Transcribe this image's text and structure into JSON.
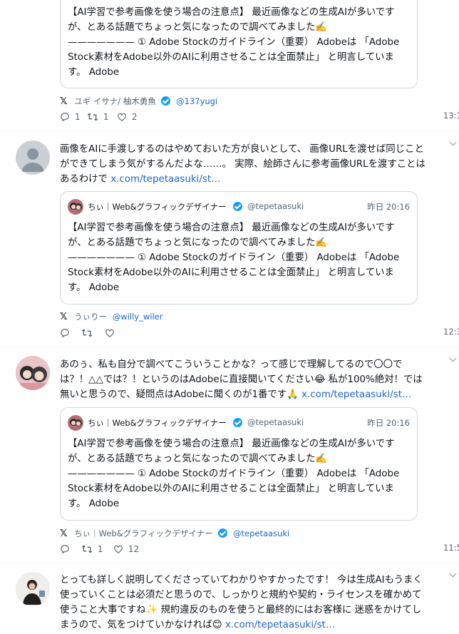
{
  "items": [
    {
      "quote_text": "【AI学習で参考画像を使う場合の注意点】 最近画像などの生成AIが多いですが、とある話題でちょっと気になったので調べてみました✍️\n——————— ① Adobe Stockのガイドライン（重要） Adobeは 「Adobe Stock素材をAdobe以外のAIに利用させることは全面禁止」 と明言しています。 Adobe",
      "source_name": "ユギ イサナ/ 柚木勇魚",
      "source_handle": "@137yugi",
      "reply_count": "1",
      "retweet_count": "1",
      "like_count": "2",
      "time": "13:1"
    },
    {
      "text": "画像をAIに手渡しするのはやめておいた方が良いとして、 画像URLを渡せば同じことができてしまう気がするんだよな……。 実際、絵師さんに参考画像URLを渡すことはあるわけで ",
      "link": "x.com/tepetaasuki/st…",
      "quote_name": "ちぃ｜Web&グラフィックデザイナー",
      "quote_handle": "@tepetaasuki",
      "quote_time": "昨日 20:16",
      "quote_text": "【AI学習で参考画像を使う場合の注意点】 最近画像などの生成AIが多いですが、とある話題でちょっと気になったので調べてみました✍️\n——————— ① Adobe Stockのガイドライン（重要） Adobeは 「Adobe Stock素材をAdobe以外のAIに利用させることは全面禁止」 と明言しています。 Adobe",
      "source_name": "うぃりー",
      "source_handle": "@willy_wiler",
      "reply_count": "",
      "retweet_count": "",
      "like_count": "",
      "time": "12:3"
    },
    {
      "text": "あのぅ、私も自分で調べてこういうことかな？って感じで理解してるので〇〇では？！△△では？！というのはAdobeに直接聞いてください😂 私が100%絶対！では無いと思うので、疑問点はAdobeに聞くのが1番です🙏 ",
      "link": "x.com/tepetaasuki/st…",
      "quote_name": "ちぃ｜Web&グラフィックデザイナー",
      "quote_handle": "@tepetaasuki",
      "quote_time": "昨日 20:16",
      "quote_text": "【AI学習で参考画像を使う場合の注意点】 最近画像などの生成AIが多いですが、とある話題でちょっと気になったので調べてみました✍️\n——————— ① Adobe Stockのガイドライン（重要） Adobeは 「Adobe Stock素材をAdobe以外のAIに利用させることは全面禁止」 と明言しています。 Adobe",
      "source_name": "ちぃ｜Web&グラフィックデザイナー",
      "source_handle": "@tepetaasuki",
      "reply_count": "",
      "retweet_count": "1",
      "like_count": "12",
      "time": "11:5"
    },
    {
      "text": "とっても詳しく説明してくださっていてわかりやすかったです！ 今は生成AIもうまく使っていくことは必須だと思うので、しっかりと規約や契約・ライセンスを確かめて使うこと大事ですね✨ 規約違反のものを使うと最終的にはお客様に 迷惑をかけてしまうので、気をつけていかなければ😊 ",
      "link": "x.com/tepetaasuki/st…"
    }
  ],
  "icons": {
    "x_logo": "𝕏",
    "reply": "reply-icon",
    "retweet": "retweet-icon",
    "like": "heart-icon",
    "more": "chevron-down-icon"
  },
  "colors": {
    "link": "#1d64c7",
    "verified": "#1d9bf0",
    "muted": "#536471"
  }
}
